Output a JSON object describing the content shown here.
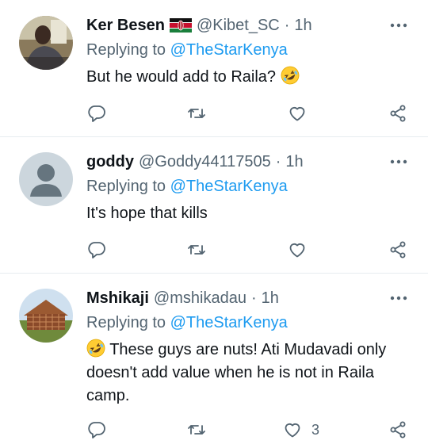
{
  "tweets": [
    {
      "name": "Ker Besen",
      "has_flag": true,
      "handle": "@Kibet_SC",
      "separator": "·",
      "time": "1h",
      "replying_prefix": "Replying to",
      "replying_to": "@TheStarKenya",
      "text": "But he would add to Raila?",
      "likes": ""
    },
    {
      "name": "goddy",
      "has_flag": false,
      "handle": "@Goddy44117505",
      "separator": "·",
      "time": "1h",
      "replying_prefix": "Replying to",
      "replying_to": "@TheStarKenya",
      "text": "It's hope that kills",
      "likes": ""
    },
    {
      "name": "Mshikaji",
      "has_flag": false,
      "handle": "@mshikadau",
      "separator": "·",
      "time": "1h",
      "replying_prefix": "Replying to",
      "replying_to": "@TheStarKenya",
      "text": "These guys are nuts! Ati Mudavadi only doesn't add value when he is not in Raila camp.",
      "likes": "3"
    }
  ],
  "icons": {
    "more": "more-horizontal-icon",
    "reply": "reply-bubble-icon",
    "retweet": "retweet-icon",
    "like": "heart-icon",
    "share": "share-icon",
    "emoji": "rolling-on-floor-laughing-emoji",
    "flag": "kenya-flag-icon"
  },
  "colors": {
    "text": "#0f1419",
    "secondary": "#536471",
    "mention": "#1d9bf0",
    "divider": "#e6ecf0"
  }
}
